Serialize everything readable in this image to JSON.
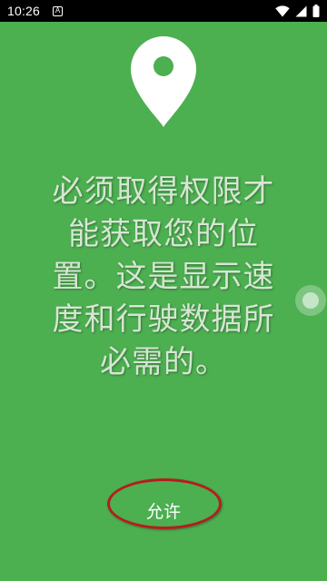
{
  "status_bar": {
    "time": "10:26",
    "notification_icon": "a-notification-icon",
    "icons": [
      "wifi-icon",
      "cellular-signal-icon",
      "battery-icon"
    ]
  },
  "main": {
    "background_color": "#4caf50",
    "location_icon": "location-pin-icon",
    "message_lines": [
      "必须取得权限才",
      "能获取您的位",
      "置。这是显示速",
      "度和行驶数据所",
      "必需的。"
    ],
    "allow_button_label": "允许",
    "highlight_color": "#b71c1c"
  }
}
